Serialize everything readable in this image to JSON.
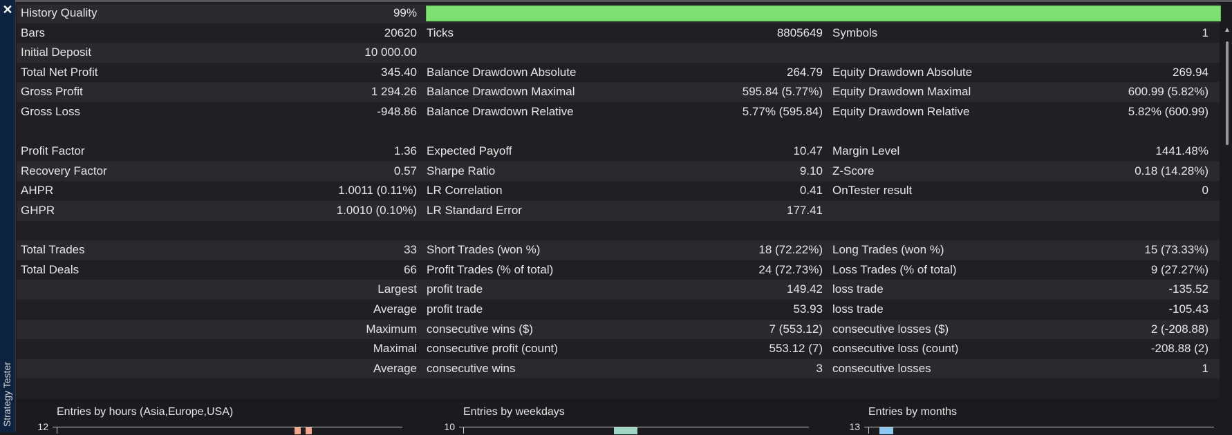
{
  "panel": {
    "title": "Strategy Tester",
    "close_glyph": "✕"
  },
  "quality": {
    "label": "History Quality",
    "value": "99%",
    "fraction": 0.99,
    "bar_color": "#7ee072"
  },
  "rows": [
    {
      "l1": "Bars",
      "v1": "20620",
      "l2": "Ticks",
      "v2": "8805649",
      "l3": "Symbols",
      "v3": "1"
    },
    {
      "l1": "Initial Deposit",
      "v1": "10 000.00",
      "l2": "",
      "v2": "",
      "l3": "",
      "v3": ""
    },
    {
      "l1": "Total Net Profit",
      "v1": "345.40",
      "l2": "Balance Drawdown Absolute",
      "v2": "264.79",
      "l3": "Equity Drawdown Absolute",
      "v3": "269.94"
    },
    {
      "l1": "Gross Profit",
      "v1": "1 294.26",
      "l2": "Balance Drawdown Maximal",
      "v2": "595.84 (5.77%)",
      "l3": "Equity Drawdown Maximal",
      "v3": "600.99 (5.82%)"
    },
    {
      "l1": "Gross Loss",
      "v1": "-948.86",
      "l2": "Balance Drawdown Relative",
      "v2": "5.77% (595.84)",
      "l3": "Equity Drawdown Relative",
      "v3": "5.82% (600.99)"
    },
    {
      "blank": true
    },
    {
      "l1": "Profit Factor",
      "v1": "1.36",
      "l2": "Expected Payoff",
      "v2": "10.47",
      "l3": "Margin Level",
      "v3": "1441.48%"
    },
    {
      "l1": "Recovery Factor",
      "v1": "0.57",
      "l2": "Sharpe Ratio",
      "v2": "9.10",
      "l3": "Z-Score",
      "v3": "0.18 (14.28%)"
    },
    {
      "l1": "AHPR",
      "v1": "1.0011 (0.11%)",
      "l2": "LR Correlation",
      "v2": "0.41",
      "l3": "OnTester result",
      "v3": "0"
    },
    {
      "l1": "GHPR",
      "v1": "1.0010 (0.10%)",
      "l2": "LR Standard Error",
      "v2": "177.41",
      "l3": "",
      "v3": ""
    },
    {
      "blank": true
    },
    {
      "l1": "Total Trades",
      "v1": "33",
      "l2": "Short Trades (won %)",
      "v2": "18 (72.22%)",
      "l3": "Long Trades (won %)",
      "v3": "15 (73.33%)"
    },
    {
      "l1": "Total Deals",
      "v1": "66",
      "l2": "Profit Trades (% of total)",
      "v2": "24 (72.73%)",
      "l3": "Loss Trades (% of total)",
      "v3": "9 (27.27%)"
    },
    {
      "l1": "",
      "v1": "Largest",
      "l2": "profit trade",
      "v2": "149.42",
      "l3": "loss trade",
      "v3": "-135.52"
    },
    {
      "l1": "",
      "v1": "Average",
      "l2": "profit trade",
      "v2": "53.93",
      "l3": "loss trade",
      "v3": "-105.43"
    },
    {
      "l1": "",
      "v1": "Maximum",
      "l2": "consecutive wins ($)",
      "v2": "7 (553.12)",
      "l3": "consecutive losses ($)",
      "v3": "2 (-208.88)"
    },
    {
      "l1": "",
      "v1": "Maximal",
      "l2": "consecutive profit (count)",
      "v2": "553.12 (7)",
      "l3": "consecutive loss (count)",
      "v3": "-208.88 (2)"
    },
    {
      "l1": "",
      "v1": "Average",
      "l2": "consecutive wins",
      "v2": "3",
      "l3": "consecutive losses",
      "v3": "1"
    },
    {
      "blank": true
    }
  ],
  "charts": [
    {
      "title": "Entries by hours (Asia,Europe,USA)",
      "ytick": "12",
      "bar_colors": [
        "#f4a58a",
        "#f4a58a"
      ]
    },
    {
      "title": "Entries by weekdays",
      "ytick": "10",
      "bar_colors": [
        "#9ed8c4"
      ]
    },
    {
      "title": "Entries by months",
      "ytick": "13",
      "bar_colors": [
        "#8ec8f0"
      ]
    }
  ]
}
